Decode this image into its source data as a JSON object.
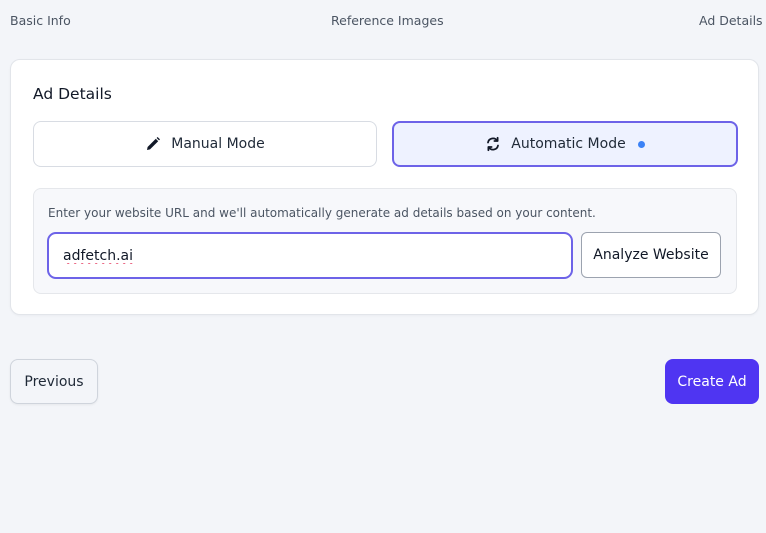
{
  "stepper": {
    "steps": [
      {
        "label": "Basic Info"
      },
      {
        "label": "Reference Images"
      },
      {
        "label": "Ad Details"
      }
    ]
  },
  "card": {
    "title": "Ad Details",
    "modes": {
      "manual": {
        "label": "Manual Mode",
        "icon": "pencil-icon"
      },
      "automatic": {
        "label": "Automatic Mode",
        "icon": "refresh-icon",
        "active": true
      }
    },
    "helper_text": "Enter your website URL and we'll automatically generate ad details based on your content.",
    "url_input": {
      "value": "adfetch.ai"
    },
    "analyze_label": "Analyze Website"
  },
  "footer": {
    "previous_label": "Previous",
    "create_label": "Create Ad"
  },
  "colors": {
    "accent": "#6d63e8",
    "primary": "#4f35f2",
    "active_dot": "#3b82f6",
    "background": "#f3f5f9"
  }
}
